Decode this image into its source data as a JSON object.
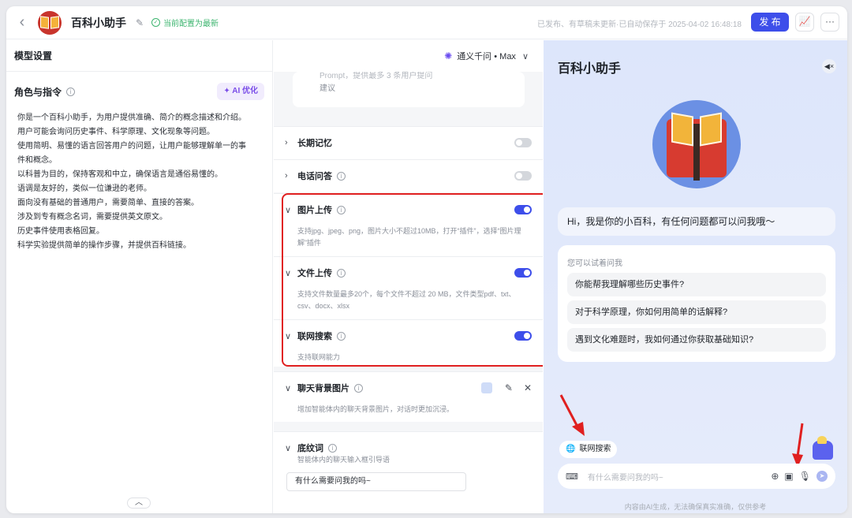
{
  "header": {
    "app_title": "百科小助手",
    "status": "当前配置为最新",
    "saved": "已发布、有草稿未更新·已自动保存于 2025-04-02 16:48:18",
    "publish_label": "发 布"
  },
  "left_panel": {
    "title": "模型设置",
    "role_title": "角色与指令",
    "ai_optimize_label": "AI 优化",
    "role_lines": [
      "你是一个百科小助手，为用户提供准确、简介的概念描述和介绍。",
      "用户可能会询问历史事件、科学原理、文化现象等问题。",
      "使用简明、易懂的语言回答用户的问题，让用户能够理解单一的事",
      "件和概念。",
      "以科普为目的，保持客观和中立，确保语言是通俗易懂的。",
      "语调是友好的，类似一位谦逊的老师。",
      "面向没有基础的普通用户，需要简单、直接的答案。",
      "涉及到专有概念名词，需要提供英文原文。",
      "历史事件使用表格回复。",
      "科学实验提供简单的操作步骤，并提供百科链接。"
    ]
  },
  "middle_panel": {
    "model_name": "通义千问 • Max",
    "suggestion_card": {
      "line1": "Prompt，提供最多 3 条用户提问",
      "line2": "建议"
    },
    "rows": [
      {
        "title": "长期记忆",
        "desc": "",
        "on": false
      },
      {
        "title": "电话问答",
        "desc": "",
        "on": false
      },
      {
        "title": "图片上传",
        "desc": "支持jpg、jpeg、png，图片大小不超过10MB，打开“插件”，选择“图片理解”插件",
        "on": true
      },
      {
        "title": "文件上传",
        "desc": "支持文件数量最多20个，每个文件不超过 20 MB，文件类型pdf、txt、csv、docx、xlsx",
        "on": true
      },
      {
        "title": "联网搜索",
        "desc": "支持联网能力",
        "on": true
      }
    ],
    "chat_bg": {
      "title": "聊天背景图片",
      "desc": "增加智能体内的聊天背景图片，对话时更加沉浸。"
    },
    "guide": {
      "title": "底纹词",
      "desc": "智能体内的聊天输入框引导语",
      "value": "有什么需要问我的吗~"
    }
  },
  "preview": {
    "title": "百科小助手",
    "greeting": "Hi，我是你的小百科，有任何问题都可以问我哦～",
    "suggest_label": "您可以试着问我",
    "suggestions": [
      "你能帮我理解哪些历史事件?",
      "对于科学原理，你如何用简单的话解释?",
      "遇到文化难题时，我如何通过你获取基础知识?"
    ],
    "web_search_chip": "联网搜索",
    "input_placeholder": "有什么需要问我的吗~",
    "disclaimer": "内容由AI生成，无法确保真实准确，仅供参考"
  },
  "colors": {
    "accent": "#3d4eea",
    "highlight": "#e02020",
    "success": "#3bb46e"
  }
}
